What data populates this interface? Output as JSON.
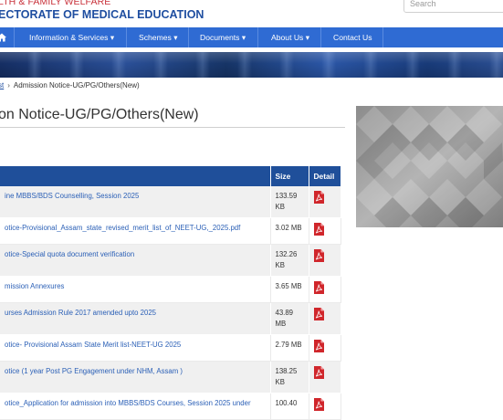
{
  "header": {
    "department": "LTH & FAMILY WELFARE",
    "directorate": "ECTORATE OF MEDICAL EDUCATION",
    "search_placeholder": "Search"
  },
  "nav": {
    "home_icon": "home-icon",
    "items": [
      {
        "label": "Information & Services ▾"
      },
      {
        "label": "Schemes ▾"
      },
      {
        "label": "Documents ▾"
      },
      {
        "label": "About Us ▾"
      },
      {
        "label": "Contact Us"
      }
    ]
  },
  "breadcrumb": {
    "prev": "st",
    "current": "Admission Notice-UG/PG/Others(New)"
  },
  "page": {
    "title": "on Notice-UG/PG/Others(New)"
  },
  "table": {
    "headers": {
      "title": "",
      "size": "Size",
      "detail": "Detail"
    },
    "detail_icon": "pdf-icon",
    "rows": [
      {
        "title": "ine MBBS/BDS Counselling, Session 2025",
        "size": "133.59 KB"
      },
      {
        "title": "otice-Provisional_Assam_state_revised_merit_list_of_NEET-UG,_2025.pdf",
        "size": "3.02 MB"
      },
      {
        "title": "otice-Special quota document verification",
        "size": "132.26 KB"
      },
      {
        "title": "mission Annexures",
        "size": "3.65 MB"
      },
      {
        "title": "urses Admission Rule 2017 amended upto 2025",
        "size": "43.89 MB"
      },
      {
        "title": "otice- Provisional Assam State Merit list-NEET-UG 2025",
        "size": "2.79 MB"
      },
      {
        "title": "otice (1 year Post PG Engagement under NHM, Assam )",
        "size": "138.25 KB"
      },
      {
        "title": "otice_Application for admission into MBBS/BDS Courses, Session 2025 under",
        "size": "100.40"
      }
    ]
  },
  "colors": {
    "nav_bg": "#2f6bd3",
    "table_header_bg": "#1f4f9a",
    "link": "#2a5fb6",
    "dept_red": "#c8313a",
    "directorate_blue": "#1f4ea0",
    "pdf_red": "#d0262b"
  }
}
